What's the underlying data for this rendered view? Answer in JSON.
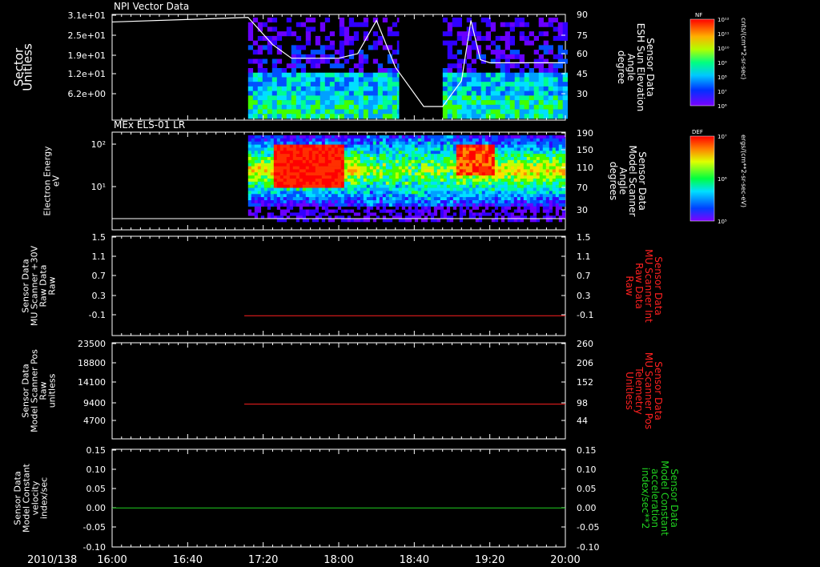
{
  "date_label": "2010/138",
  "time_ticks": [
    "16:00",
    "16:40",
    "17:20",
    "18:00",
    "18:40",
    "19:20",
    "20:00"
  ],
  "chart_data": [
    {
      "type": "heatmap",
      "title": "NPI Vector Data",
      "ylabel": "Sector\nUnitless",
      "yticks": [
        "3.1e+01",
        "2.5e+01",
        "1.9e+01",
        "1.2e+01",
        "6.2e+00"
      ],
      "y2label": "Sensor Data\nESH Sun Elevation\nAngle\ndegree",
      "y2ticks": [
        "90",
        "75",
        "60",
        "45",
        "30"
      ],
      "y2lim": [
        20,
        90
      ],
      "line_series": {
        "x": [
          "16:00",
          "17:12",
          "17:25",
          "17:35",
          "18:00",
          "18:10",
          "18:20",
          "18:30",
          "18:45",
          "18:55",
          "19:05",
          "19:10",
          "19:15",
          "19:20",
          "20:00"
        ],
        "y": [
          85,
          88,
          70,
          61,
          61,
          64,
          86,
          55,
          29,
          29,
          46,
          86,
          60,
          58,
          58
        ]
      },
      "colorbar": {
        "label": "NF",
        "unit": "cnts/(cm**2-sr-sec)",
        "ticks": [
          "10¹²",
          "10¹¹",
          "10¹⁰",
          "10⁹",
          "10⁸",
          "10⁷",
          "10⁶"
        ]
      }
    },
    {
      "type": "heatmap",
      "title": "MEx ELS-01 LR",
      "ylabel": "Electron Energy\neV",
      "yticks": [
        "10²",
        "10¹"
      ],
      "y2label": "Sensor Data\nModel Scanner\nAngle\ndegrees",
      "y2ticks": [
        "190",
        "150",
        "110",
        "70",
        "30"
      ],
      "colorbar": {
        "label": "DEF",
        "unit": "ergs/(cm**2-sr-sec-eV)",
        "ticks": [
          "10⁷",
          "10⁶",
          "10⁵"
        ]
      }
    },
    {
      "type": "line",
      "ylabel": "Sensor Data\nMU Scanner +30V\nRaw Data\nRaw",
      "yticks": [
        "1.5",
        "1.1",
        "0.7",
        "0.3",
        "-0.1"
      ],
      "ylim": [
        -0.5,
        1.5
      ],
      "y2label": "Sensor Data\nMU Scanner Int\nRaw Data\nRaw",
      "y2ticks": [
        "1.5",
        "1.1",
        "0.7",
        "0.3",
        "-0.1"
      ],
      "series": [
        {
          "x": [
            "17:10",
            "20:00"
          ],
          "y": [
            -0.1,
            -0.1
          ],
          "color": "#ff2020"
        }
      ]
    },
    {
      "type": "line",
      "ylabel": "Sensor Data\nModel Scanner Pos\nRaw\nunitless",
      "yticks": [
        "23500",
        "18800",
        "14100",
        "9400",
        "4700"
      ],
      "ylim": [
        0,
        23500
      ],
      "y2label": "Sensor Data\nMU Scanner Pos\nTelemetry\nUnitless",
      "y2ticks": [
        "260",
        "206",
        "152",
        "98",
        "44"
      ],
      "series": [
        {
          "x": [
            "17:10",
            "20:00"
          ],
          "y": [
            8500,
            8500
          ],
          "color": "#ff2020"
        }
      ]
    },
    {
      "type": "line",
      "ylabel": "Sensor Data\nModel Constant\nvelocity\nindex/sec",
      "yticks": [
        "0.15",
        "0.10",
        "0.05",
        "0.00",
        "-0.05",
        "-0.10"
      ],
      "ylim": [
        -0.1,
        0.15
      ],
      "y2label": "Sensor Data\nModel Constant\nacceleration\nindex/sec**2",
      "y2ticks": [
        "0.15",
        "0.10",
        "0.05",
        "0.00",
        "-0.05",
        "-0.10"
      ],
      "series": [
        {
          "x": [
            "16:00",
            "20:00"
          ],
          "y": [
            0.0,
            0.0
          ],
          "color": "#20d020"
        }
      ]
    }
  ],
  "colors": {
    "red": "#ff2020",
    "green": "#20d020",
    "white": "#ffffff"
  }
}
